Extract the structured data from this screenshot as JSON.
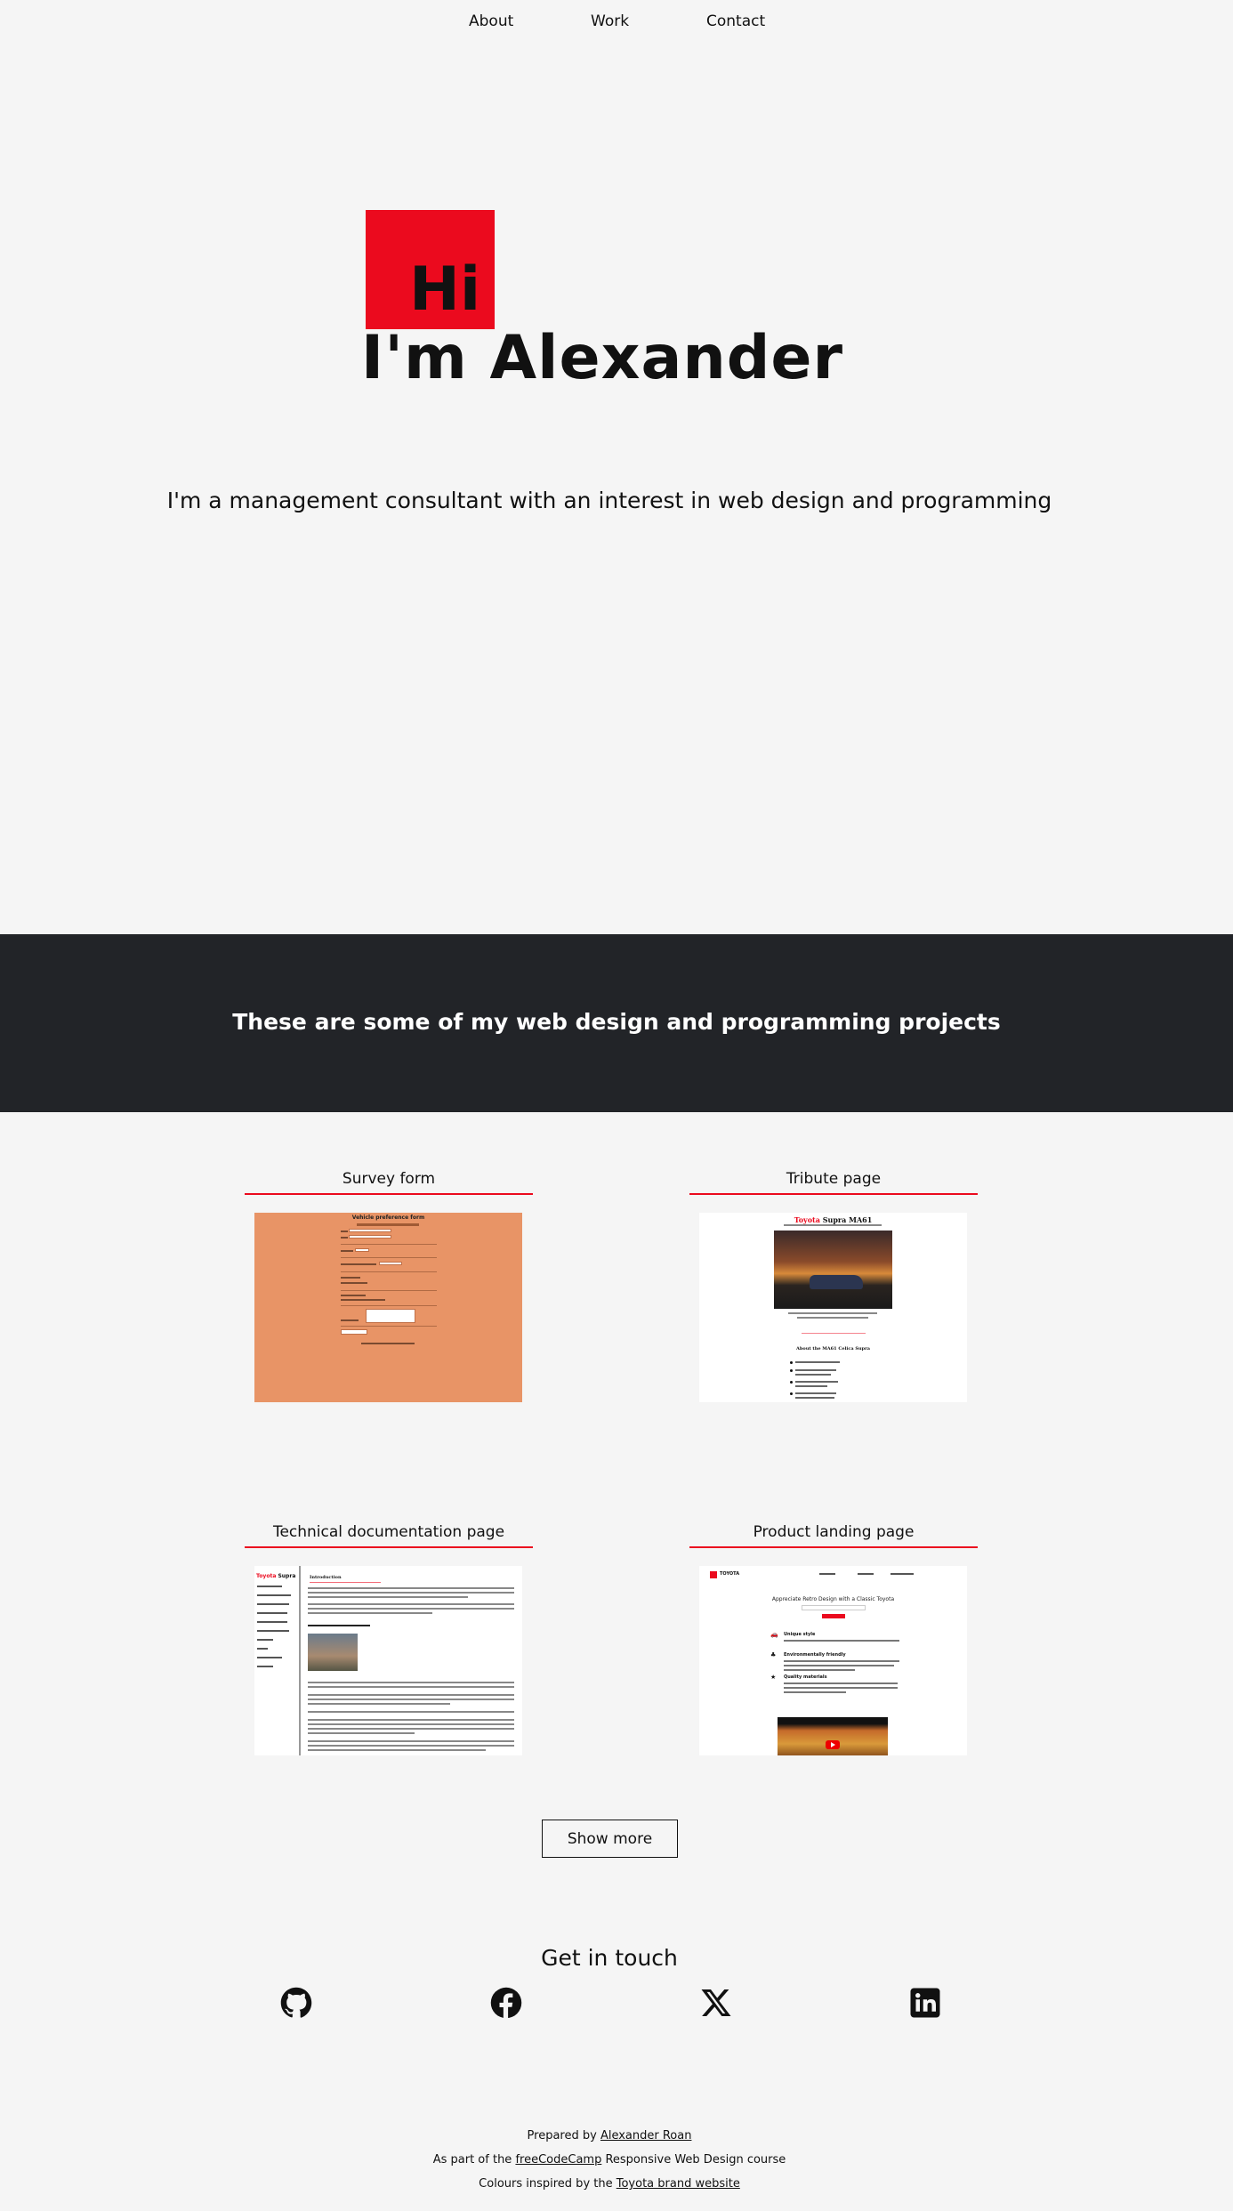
{
  "nav": {
    "about": "About",
    "work": "Work",
    "contact": "Contact"
  },
  "hero": {
    "hi": "Hi",
    "name": "I'm Alexander",
    "tagline": "I'm a management consultant with an interest in web design and programming"
  },
  "banner": {
    "heading": "These are some of my web design and programming projects"
  },
  "projects": [
    {
      "title": "Survey form",
      "thumb": {
        "title": "Vehicle preference form"
      }
    },
    {
      "title": "Tribute page",
      "thumb": {
        "brand": "Toyota",
        "model": "Supra MA61",
        "section": "About the MA61 Celica Supra"
      }
    },
    {
      "title": "Technical documentation page",
      "thumb": {
        "brand": "Toyota",
        "model": "Supra",
        "heading": "Introduction"
      }
    },
    {
      "title": "Product landing page",
      "thumb": {
        "logo": "TOYOTA",
        "heading": "Appreciate Retro Design with a Classic Toyota",
        "features": [
          "Unique style",
          "Environmentally friendly",
          "Quality materials"
        ]
      }
    }
  ],
  "show_more": "Show more",
  "contact": {
    "heading": "Get in touch",
    "icons": [
      "github-icon",
      "facebook-icon",
      "x-icon",
      "linkedin-icon"
    ]
  },
  "footer": {
    "line1_prefix": "Prepared by ",
    "line1_link": "Alexander Roan",
    "line2_prefix": "As part of the ",
    "line2_link": "freeCodeCamp",
    "line2_suffix": " Responsive Web Design course",
    "line3_prefix": "Colours inspired by the ",
    "line3_link": "Toyota brand website"
  },
  "colors": {
    "accent": "#eb0a1e",
    "banner_bg": "#222428",
    "page_bg": "#f5f5f5"
  }
}
